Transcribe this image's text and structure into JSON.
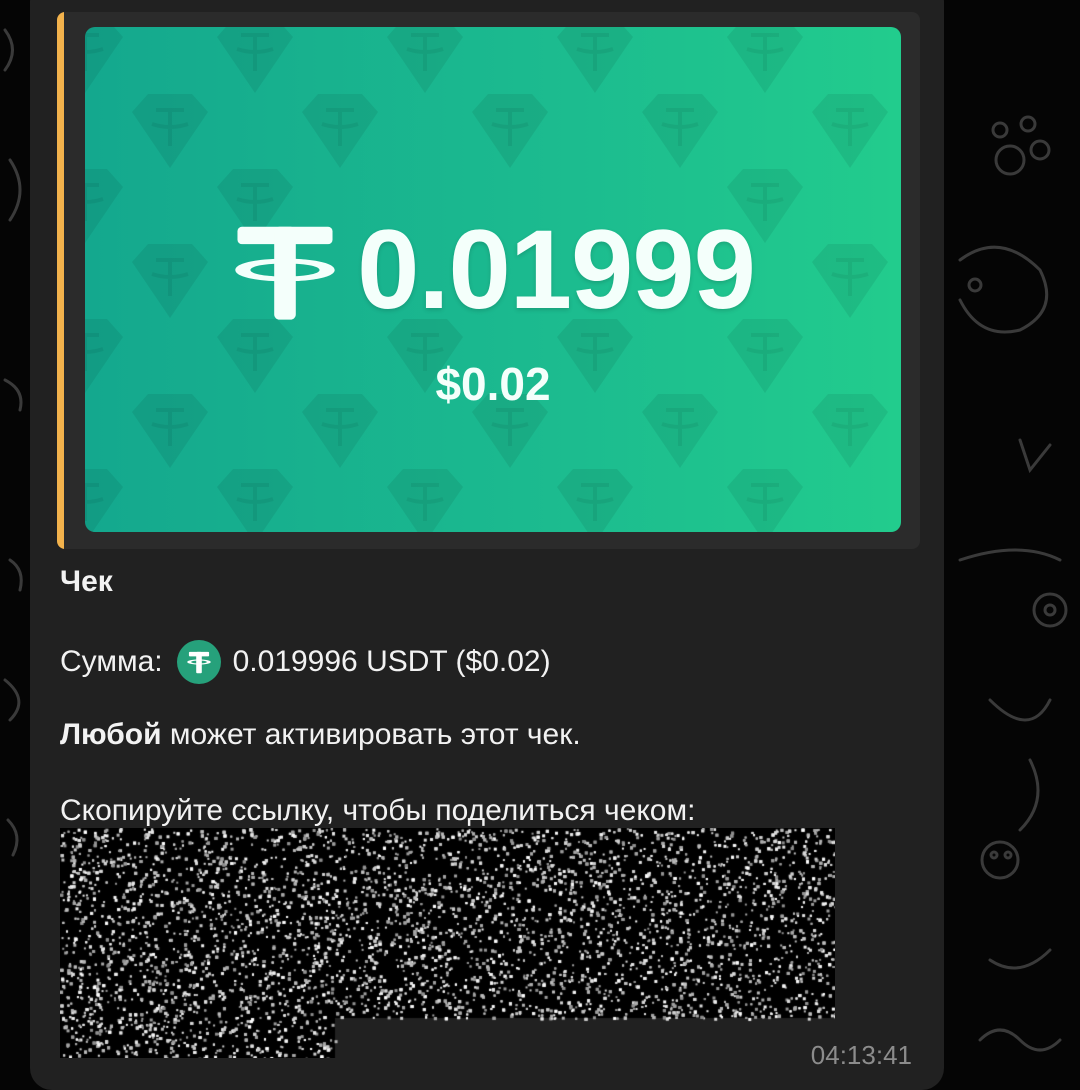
{
  "card": {
    "crypto_amount": "0.01999",
    "fiat_amount": "$0.02",
    "logo_icon": "tether-icon"
  },
  "message": {
    "title": "Чек",
    "sum_label": "Сумма:",
    "sum_value": "0.019996 USDT ($0.02)",
    "anyone_bold": "Любой",
    "anyone_rest": " может активировать этот чек.",
    "copy_text": "Скопируйте ссылку, чтобы поделиться чеком:",
    "link_redacted": true
  },
  "timestamp": "04:13:41",
  "colors": {
    "bubble": "#212121",
    "accent": "#f2b24c",
    "card_start": "#14a88e",
    "card_end": "#22cc8d",
    "coin": "#26a17b"
  }
}
